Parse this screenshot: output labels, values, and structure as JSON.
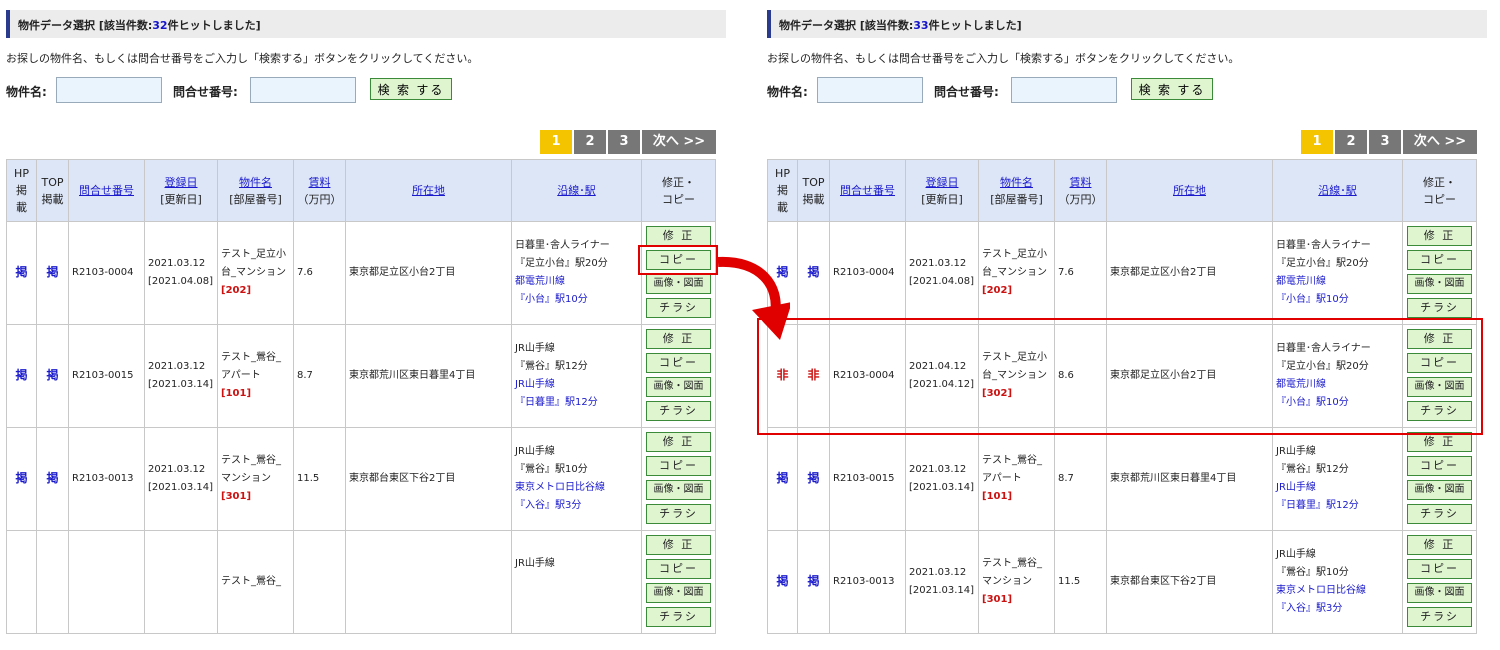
{
  "colors": {
    "accent": "#2a3a8c",
    "link": "#1a1acc",
    "alert": "#cc1111",
    "highlight": "#e00000",
    "pager_active": "#f4c400",
    "button_bg": "#dff5d0"
  },
  "shared": {
    "instruction": "お探しの物件名、もしくは問合せ番号をご入力し「検索する」ボタンをクリックしてください。",
    "search_name_label": "物件名:",
    "search_inquiry_label": "問合せ番号:",
    "search_button": "検 索 する",
    "pager": [
      "1",
      "2",
      "3"
    ],
    "pager_next": "次へ >>",
    "headers": {
      "hp": "HP\n掲\n載",
      "top": "TOP\n掲載",
      "inquiry": "問合せ番号",
      "date": "登録日",
      "date_sub": "[更新日]",
      "name": "物件名",
      "name_sub": "[部屋番号]",
      "rent": "賃料",
      "rent_sub": "（万円）",
      "address": "所在地",
      "line": "沿線･駅",
      "edit": "修正・\nコピー"
    },
    "actions": {
      "edit": "修 正",
      "copy": "コピー",
      "images": "画像・図面",
      "flyer": "チラシ"
    }
  },
  "panels": [
    {
      "title_prefix": "物件データ選択 [該当件数:",
      "count": "32",
      "title_suffix": "件ヒットしました]",
      "rows": [
        {
          "hp": "掲",
          "top": "掲",
          "flag": "on",
          "inquiry": "R2103-0004",
          "registered": "2021.03.12",
          "updated": "[2021.04.08]",
          "name": "テスト_足立小台_マンション",
          "room": "[202]",
          "rent": "7.6",
          "address": "東京都足立区小台2丁目",
          "line1": "日暮里･舎人ライナー",
          "station1": "『足立小台』駅20分",
          "line2": "都電荒川線",
          "station2": "『小台』駅10分"
        },
        {
          "hp": "掲",
          "top": "掲",
          "flag": "on",
          "inquiry": "R2103-0015",
          "registered": "2021.03.12",
          "updated": "[2021.03.14]",
          "name": "テスト_鶯谷_アパート",
          "room": "[101]",
          "rent": "8.7",
          "address": "東京都荒川区東日暮里4丁目",
          "line1": "JR山手線",
          "station1": "『鶯谷』駅12分",
          "line2": "JR山手線",
          "station2": "『日暮里』駅12分"
        },
        {
          "hp": "掲",
          "top": "掲",
          "flag": "on",
          "inquiry": "R2103-0013",
          "registered": "2021.03.12",
          "updated": "[2021.03.14]",
          "name": "テスト_鶯谷_マンション",
          "room": "[301]",
          "rent": "11.5",
          "address": "東京都台東区下谷2丁目",
          "line1": "JR山手線",
          "station1": "『鶯谷』駅10分",
          "line2": "東京メトロ日比谷線",
          "station2": "『入谷』駅3分"
        },
        {
          "hp": "",
          "top": "",
          "flag": "on",
          "inquiry": "",
          "registered": "",
          "updated": "",
          "name": "テスト_鶯谷_",
          "room": "",
          "rent": "",
          "address": "",
          "line1": "JR山手線",
          "station1": "",
          "line2": "",
          "station2": ""
        }
      ]
    },
    {
      "title_prefix": "物件データ選択 [該当件数:",
      "count": "33",
      "title_suffix": "件ヒットしました]",
      "rows": [
        {
          "hp": "掲",
          "top": "掲",
          "flag": "on",
          "inquiry": "R2103-0004",
          "registered": "2021.03.12",
          "updated": "[2021.04.08]",
          "name": "テスト_足立小台_マンション",
          "room": "[202]",
          "rent": "7.6",
          "address": "東京都足立区小台2丁目",
          "line1": "日暮里･舎人ライナー",
          "station1": "『足立小台』駅20分",
          "line2": "都電荒川線",
          "station2": "『小台』駅10分"
        },
        {
          "hp": "非",
          "top": "非",
          "flag": "off",
          "inquiry": "R2103-0004",
          "registered": "2021.04.12",
          "updated": "[2021.04.12]",
          "name": "テスト_足立小台_マンション",
          "room": "[302]",
          "rent": "8.6",
          "address": "東京都足立区小台2丁目",
          "line1": "日暮里･舎人ライナー",
          "station1": "『足立小台』駅20分",
          "line2": "都電荒川線",
          "station2": "『小台』駅10分"
        },
        {
          "hp": "掲",
          "top": "掲",
          "flag": "on",
          "inquiry": "R2103-0015",
          "registered": "2021.03.12",
          "updated": "[2021.03.14]",
          "name": "テスト_鶯谷_アパート",
          "room": "[101]",
          "rent": "8.7",
          "address": "東京都荒川区東日暮里4丁目",
          "line1": "JR山手線",
          "station1": "『鶯谷』駅12分",
          "line2": "JR山手線",
          "station2": "『日暮里』駅12分"
        },
        {
          "hp": "掲",
          "top": "掲",
          "flag": "on",
          "inquiry": "R2103-0013",
          "registered": "2021.03.12",
          "updated": "[2021.03.14]",
          "name": "テスト_鶯谷_マンション",
          "room": "[301]",
          "rent": "11.5",
          "address": "東京都台東区下谷2丁目",
          "line1": "JR山手線",
          "station1": "『鶯谷』駅10分",
          "line2": "東京メトロ日比谷線",
          "station2": "『入谷』駅3分"
        }
      ]
    }
  ]
}
